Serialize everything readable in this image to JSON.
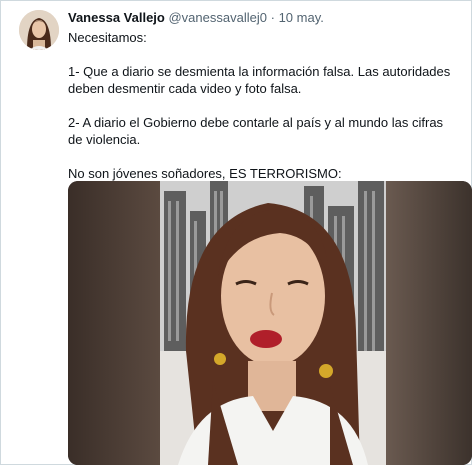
{
  "tweet": {
    "author_name": "Vanessa Vallejo",
    "handle": "@vanessavallej0",
    "separator": "·",
    "date": "10 may.",
    "lines": [
      "Necesitamos:",
      "1- Que a diario se desmienta la información falsa. Las autoridades deben desmentir cada video y foto falsa.",
      "2- A diario el Gobierno debe contarle al país y al mundo las cifras de violencia.",
      "No son jóvenes soñadores, ES TERRORISMO:"
    ]
  },
  "colors": {
    "name_text": "#0f1419",
    "muted_text": "#536471",
    "border": "#cfd9de",
    "lip": "#b01f2a",
    "hair": "#5a3120",
    "earring": "#d4a82a"
  },
  "icons": {
    "avatar": "profile-photo",
    "video": "video-still-woman"
  }
}
